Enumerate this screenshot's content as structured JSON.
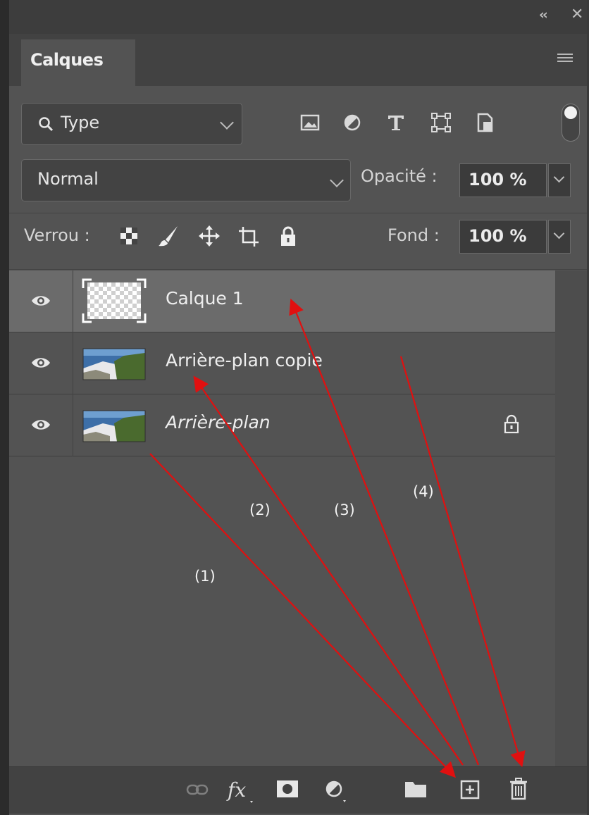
{
  "panel": {
    "tab_title": "Calques",
    "collapse_glyph": "‹‹",
    "close_glyph": "✕"
  },
  "filter": {
    "label": "Type",
    "icons": [
      "image-filter-icon",
      "adjustment-filter-icon",
      "type-filter-icon",
      "shape-filter-icon",
      "smart-object-filter-icon"
    ]
  },
  "blend": {
    "mode": "Normal",
    "opacity_label": "Opacité :",
    "opacity_value": "100 %"
  },
  "lock": {
    "label": "Verrou :",
    "fill_label": "Fond :",
    "fill_value": "100 %",
    "icons": [
      "lock-transparent-icon",
      "lock-image-icon",
      "lock-position-icon",
      "lock-artboard-icon",
      "lock-all-icon"
    ]
  },
  "layers": [
    {
      "name": "Calque 1",
      "selected": true,
      "italic": false,
      "locked": false,
      "thumb": "transparent"
    },
    {
      "name": "Arrière-plan copie",
      "selected": false,
      "italic": false,
      "locked": false,
      "thumb": "landscape"
    },
    {
      "name": "Arrière-plan",
      "selected": false,
      "italic": true,
      "locked": true,
      "thumb": "landscape"
    }
  ],
  "annotations": [
    "(1)",
    "(2)",
    "(3)",
    "(4)"
  ],
  "colors": {
    "panel_bg": "#535353",
    "selected_row": "#6b6b6b",
    "annotation_arrow": "#e01010"
  },
  "bottom_icons": [
    "link-layers-icon",
    "fx-icon",
    "layer-mask-icon",
    "adjustment-layer-icon",
    "group-folder-icon",
    "new-layer-icon",
    "trash-icon"
  ]
}
